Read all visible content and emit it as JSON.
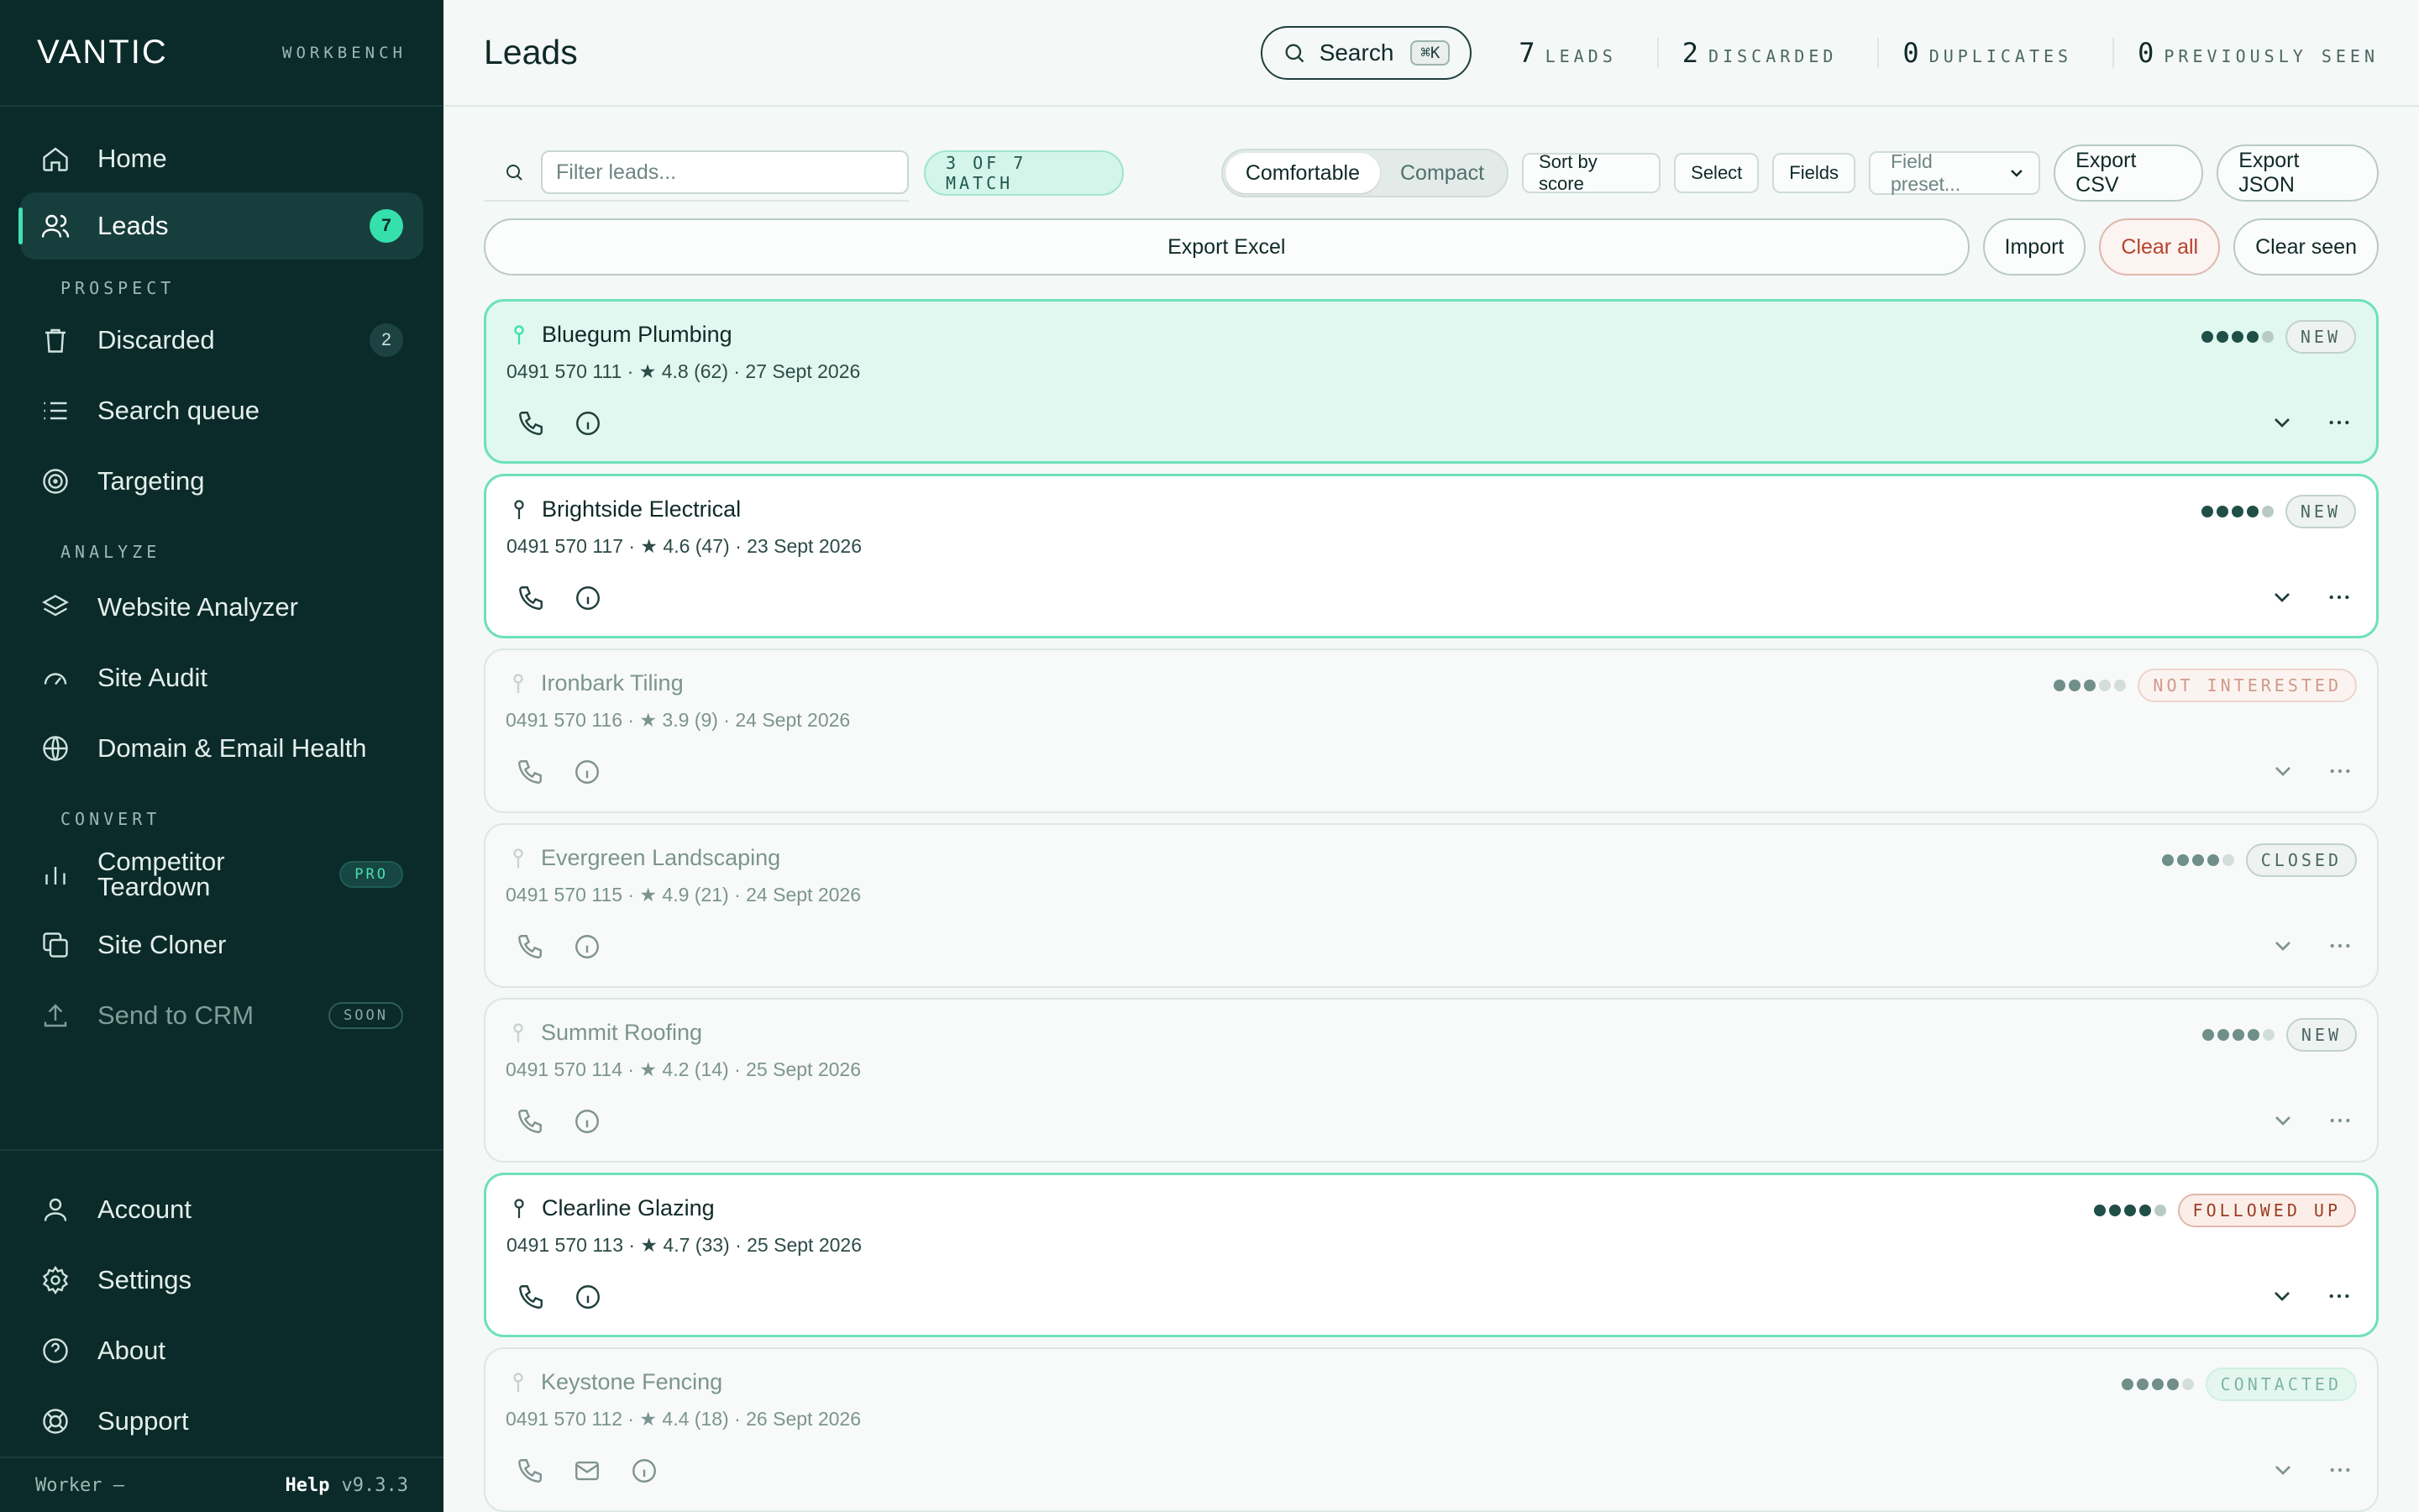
{
  "brand": {
    "logo": "VANTIC",
    "subtitle": "WORKBENCH"
  },
  "sidebar": {
    "home": "Home",
    "leads": {
      "label": "Leads",
      "count": "7"
    },
    "sections": {
      "prospect": "PROSPECT",
      "analyze": "ANALYZE",
      "convert": "CONVERT"
    },
    "discarded": {
      "label": "Discarded",
      "count": "2"
    },
    "search_queue": "Search queue",
    "targeting": "Targeting",
    "website_analyzer": "Website Analyzer",
    "site_audit": "Site Audit",
    "domain_health": "Domain & Email Health",
    "competitor": {
      "line1": "Competitor",
      "line2": "Teardown",
      "tag": "PRO"
    },
    "site_cloner": "Site Cloner",
    "send_crm": {
      "label": "Send to CRM",
      "tag": "SOON"
    },
    "account": "Account",
    "settings": "Settings",
    "about": "About",
    "support": "Support",
    "footer": {
      "worker": "Worker —",
      "help": "Help",
      "version": "v9.3.3"
    }
  },
  "topbar": {
    "title": "Leads",
    "search": {
      "label": "Search",
      "shortcut": "⌘K"
    },
    "stats": [
      {
        "n": "7",
        "label": "LEADS"
      },
      {
        "n": "2",
        "label": "DISCARDED"
      },
      {
        "n": "0",
        "label": "DUPLICATES"
      },
      {
        "n": "0",
        "label": "PREVIOUSLY SEEN"
      }
    ]
  },
  "toolbar": {
    "filter_placeholder": "Filter leads...",
    "match": "3 OF 7 MATCH",
    "density": {
      "comfortable": "Comfortable",
      "compact": "Compact"
    },
    "sort": "Sort by score",
    "select": "Select",
    "fields": "Fields",
    "field_preset": "Field preset...",
    "export_csv": "Export CSV",
    "export_json": "Export JSON",
    "export_excel": "Export Excel",
    "import": "Import",
    "clear_all": "Clear all",
    "clear_seen": "Clear seen"
  },
  "colors": {
    "accent": "#35e0ac",
    "sidebar": "#0b2a2a",
    "danger": "#b5432c"
  },
  "leads": [
    {
      "name": "Bluegum Plumbing",
      "meta": "0491 570 111 · ★ 4.8 (62) · 27 Sept 2026",
      "score": 4,
      "status": "NEW"
    },
    {
      "name": "Brightside Electrical",
      "meta": "0491 570 117 · ★ 4.6 (47) · 23 Sept 2026",
      "score": 4,
      "status": "NEW"
    },
    {
      "name": "Ironbark Tiling",
      "meta": "0491 570 116 · ★ 3.9 (9) · 24 Sept 2026",
      "score": 3,
      "status": "NOT INTERESTED"
    },
    {
      "name": "Evergreen Landscaping",
      "meta": "0491 570 115 · ★ 4.9 (21) · 24 Sept 2026",
      "score": 4,
      "status": "CLOSED"
    },
    {
      "name": "Summit Roofing",
      "meta": "0491 570 114 · ★ 4.2 (14) · 25 Sept 2026",
      "score": 4,
      "status": "NEW"
    },
    {
      "name": "Clearline Glazing",
      "meta": "0491 570 113 · ★ 4.7 (33) · 25 Sept 2026",
      "score": 4,
      "status": "FOLLOWED UP"
    },
    {
      "name": "Keystone Fencing",
      "meta": "0491 570 112 · ★ 4.4 (18) · 26 Sept 2026",
      "score": 4,
      "status": "CONTACTED"
    }
  ]
}
